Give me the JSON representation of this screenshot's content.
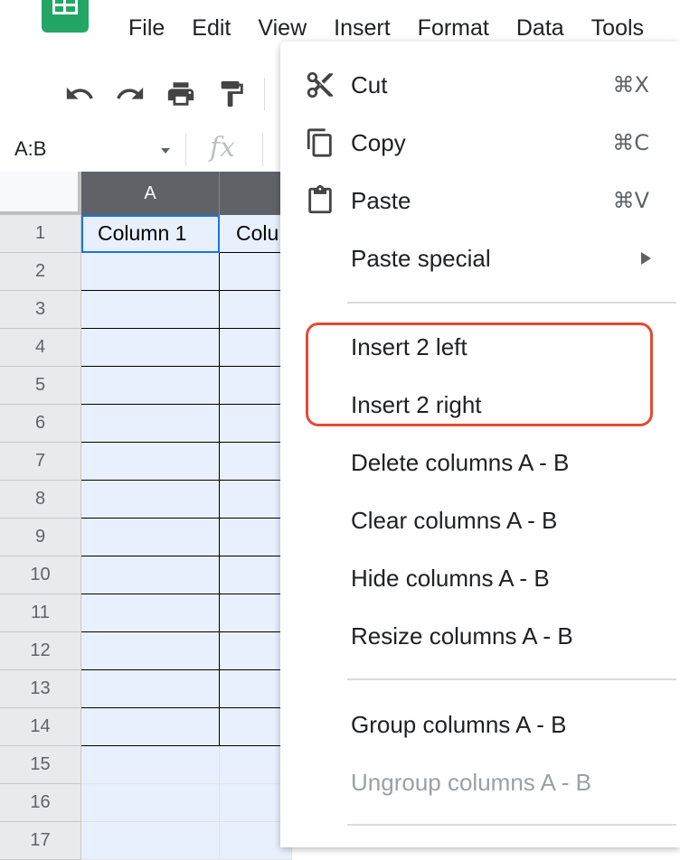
{
  "menubar": [
    "File",
    "Edit",
    "View",
    "Insert",
    "Format",
    "Data",
    "Tools"
  ],
  "toolbar": {
    "icons": [
      "undo-icon",
      "redo-icon",
      "print-icon",
      "paint-format-icon"
    ]
  },
  "formula_bar": {
    "name_box": "A:B",
    "fx_label": "fx"
  },
  "grid": {
    "column_headers": [
      "A",
      ""
    ],
    "row_numbers": [
      "1",
      "2",
      "3",
      "4",
      "5",
      "6",
      "7",
      "8",
      "9",
      "10",
      "11",
      "12",
      "13",
      "14",
      "15",
      "16",
      "17"
    ],
    "cells": {
      "A1": "Column 1",
      "B1": "Colu"
    }
  },
  "context_menu": {
    "cut": {
      "label": "Cut",
      "shortcut": "⌘X"
    },
    "copy": {
      "label": "Copy",
      "shortcut": "⌘C"
    },
    "paste": {
      "label": "Paste",
      "shortcut": "⌘V"
    },
    "paste_special": {
      "label": "Paste special"
    },
    "insert_left": {
      "label": "Insert 2 left"
    },
    "insert_right": {
      "label": "Insert 2 right"
    },
    "delete_columns": {
      "label": "Delete columns A - B"
    },
    "clear_columns": {
      "label": "Clear columns A - B"
    },
    "hide_columns": {
      "label": "Hide columns A - B"
    },
    "resize_columns": {
      "label": "Resize columns A - B"
    },
    "group_columns": {
      "label": "Group columns A - B"
    },
    "ungroup_columns": {
      "label": "Ungroup columns A - B",
      "disabled": true
    }
  },
  "colors": {
    "highlight_box": "#e34a33",
    "selection_fill": "#e8f0fe",
    "active_border": "#1a73e8",
    "header_selected": "#5f6368",
    "logo_green": "#23a566"
  }
}
